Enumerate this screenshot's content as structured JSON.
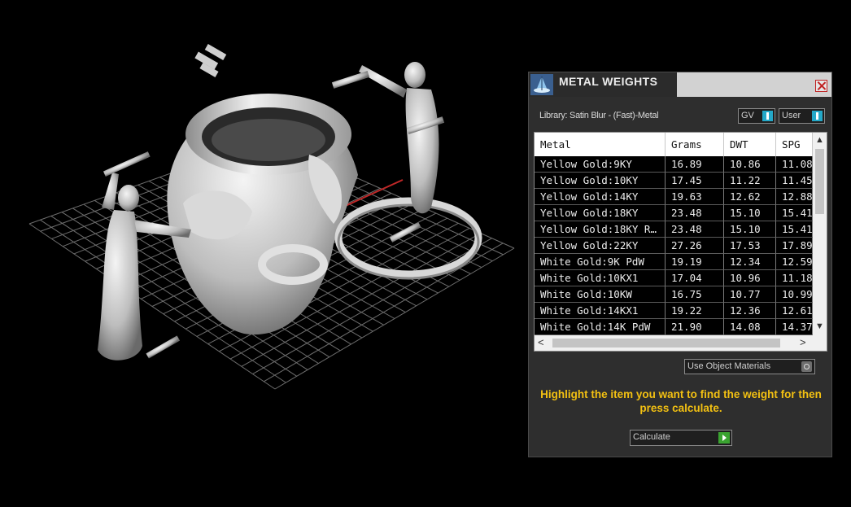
{
  "panel": {
    "title": "METAL WEIGHTS",
    "library_label": "Library: Satin Blur - (Fast)-Metal",
    "gv_label": "GV",
    "user_label": "User",
    "columns": [
      "Metal",
      "Grams",
      "DWT",
      "SPG"
    ],
    "rows": [
      [
        "Yellow Gold:9KY",
        "16.89",
        "10.86",
        "11.08"
      ],
      [
        "Yellow Gold:10KY",
        "17.45",
        "11.22",
        "11.45"
      ],
      [
        "Yellow Gold:14KY",
        "19.63",
        "12.62",
        "12.88"
      ],
      [
        "Yellow Gold:18KY",
        "23.48",
        "15.10",
        "15.41"
      ],
      [
        "Yellow Gold:18KY R…",
        "23.48",
        "15.10",
        "15.41"
      ],
      [
        "Yellow Gold:22KY",
        "27.26",
        "17.53",
        "17.89"
      ],
      [
        "White Gold:9K PdW",
        "19.19",
        "12.34",
        "12.59"
      ],
      [
        "White Gold:10KX1",
        "17.04",
        "10.96",
        "11.18"
      ],
      [
        "White Gold:10KW",
        "16.75",
        "10.77",
        "10.99"
      ],
      [
        "White Gold:14KX1",
        "19.22",
        "12.36",
        "12.61"
      ],
      [
        "White Gold:14K PdW",
        "21.90",
        "14.08",
        "14.37"
      ]
    ],
    "use_object_materials_label": "Use Object Materials",
    "hint_text": "Highlight the item you want to find the weight for then press calculate.",
    "calculate_label": "Calculate",
    "accent_color": "#24a8c8",
    "hint_color": "#f2c012"
  }
}
